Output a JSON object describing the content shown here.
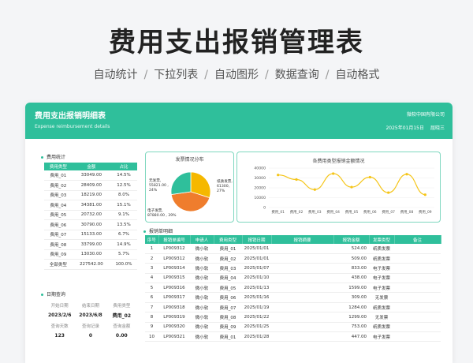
{
  "hero": {
    "title": "费用支出报销管理表",
    "features": [
      "自动统计",
      "下拉列表",
      "自动图形",
      "数据查询",
      "自动格式"
    ],
    "separator": "/"
  },
  "header": {
    "title": "费用支出报销明细表",
    "subtitle": "Expense reimbursement details",
    "company": "微软中国有限公司",
    "date": "2025年01月15日",
    "person": "屈晓三"
  },
  "stats": {
    "title": "费用统计",
    "columns": [
      "费用类型",
      "金额",
      "占比"
    ],
    "rows": [
      [
        "费用_01",
        "33049.00",
        "14.5%"
      ],
      [
        "费用_02",
        "28409.00",
        "12.5%"
      ],
      [
        "费用_03",
        "18219.00",
        "8.0%"
      ],
      [
        "费用_04",
        "34381.00",
        "15.1%"
      ],
      [
        "费用_05",
        "20732.00",
        "9.1%"
      ],
      [
        "费用_06",
        "30790.00",
        "13.5%"
      ],
      [
        "费用_07",
        "15133.00",
        "6.7%"
      ],
      [
        "费用_08",
        "33799.00",
        "14.9%"
      ],
      [
        "费用_09",
        "13030.00",
        "5.7%"
      ],
      [
        "全部类型",
        "227542.00",
        "100.0%"
      ]
    ]
  },
  "date_query": {
    "title": "日期查询",
    "labels1": [
      "开始日期",
      "结束日期",
      "费用类型"
    ],
    "values1": [
      "2023/2/6",
      "2023/6/8",
      "费用_02"
    ],
    "labels2": [
      "查询天数",
      "查询记录",
      "查询金额"
    ],
    "values2": [
      "123",
      "0",
      "0.00"
    ]
  },
  "charts": {
    "pie_title": "发票情况分布",
    "line_title": "各费用类型报销金额情况"
  },
  "chart_data": [
    {
      "type": "pie",
      "title": "发票情况分布",
      "slices": [
        {
          "name": "纸质发票",
          "value": 61300,
          "percent": "27%",
          "label": "纸质发票,\n61300,\n27%",
          "color": "#f5b800"
        },
        {
          "name": "电子发票",
          "value": 87880,
          "percent": "39%",
          "label": "电子发票,\n87880.00 , 39%",
          "color": "#ef7d2d"
        },
        {
          "name": "无发票",
          "value": 55821,
          "percent": "24%",
          "label": "无发票,\n55821.00 ,\n24%",
          "color": "#2fbf9b"
        }
      ],
      "colors": {
        "黄": "#f5b800",
        "橙": "#ef7d2d",
        "绿": "#2fbf9b"
      }
    },
    {
      "type": "line",
      "title": "各费用类型报销金额情况",
      "categories": [
        "费用_01",
        "费用_02",
        "费用_03",
        "费用_04",
        "费用_05",
        "费用_06",
        "费用_07",
        "费用_08",
        "费用_09"
      ],
      "values": [
        33049,
        28409,
        18219,
        34381,
        20732,
        30790,
        15133,
        33799,
        13030
      ],
      "yticks": [
        "40000",
        "30000",
        "20000",
        "10000",
        "0"
      ],
      "ylim": [
        0,
        40000
      ],
      "color": "#f5c518"
    }
  ],
  "detail": {
    "title": "报销单明细",
    "columns": [
      "序号",
      "报销单编号",
      "申请人",
      "费用类型",
      "报销日期",
      "报销摘要",
      "报销金额",
      "发票类型",
      "备注"
    ],
    "rows": [
      [
        "1",
        "LP009312",
        "微小软",
        "费用_01",
        "2025/01/01",
        "",
        "524.00",
        "纸质发票",
        ""
      ],
      [
        "2",
        "LP009312",
        "微小软",
        "费用_02",
        "2025/01/01",
        "",
        "509.00",
        "纸质发票",
        ""
      ],
      [
        "3",
        "LP009314",
        "微小软",
        "费用_03",
        "2025/01/07",
        "",
        "833.00",
        "电子发票",
        ""
      ],
      [
        "4",
        "LP009315",
        "微小软",
        "费用_04",
        "2025/01/10",
        "",
        "438.00",
        "电子发票",
        ""
      ],
      [
        "5",
        "LP009316",
        "微小软",
        "费用_05",
        "2025/01/13",
        "",
        "1599.00",
        "电子发票",
        ""
      ],
      [
        "6",
        "LP009317",
        "微小软",
        "费用_06",
        "2025/01/16",
        "",
        "309.00",
        "无发票",
        ""
      ],
      [
        "7",
        "LP009318",
        "微小软",
        "费用_07",
        "2025/01/19",
        "",
        "1284.00",
        "纸质发票",
        ""
      ],
      [
        "8",
        "LP009319",
        "微小软",
        "费用_08",
        "2025/01/22",
        "",
        "1299.00",
        "无发票",
        ""
      ],
      [
        "9",
        "LP009320",
        "微小软",
        "费用_09",
        "2025/01/25",
        "",
        "753.00",
        "纸质发票",
        ""
      ],
      [
        "10",
        "LP009321",
        "微小软",
        "费用_01",
        "2025/01/28",
        "",
        "447.00",
        "电子发票",
        ""
      ]
    ]
  }
}
